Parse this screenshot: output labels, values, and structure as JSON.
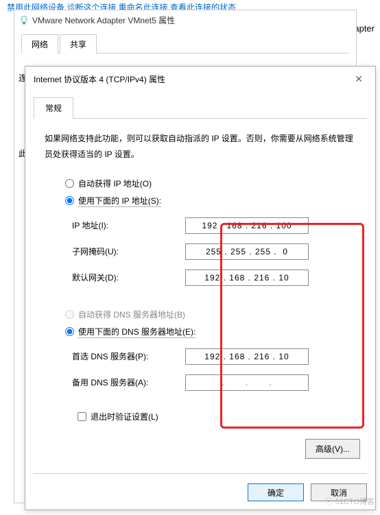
{
  "background": {
    "top_row": "禁用此网络设备    诊断这个连接    重命名此连接    查看此连接的状态",
    "right_fragment": "k Adapter"
  },
  "parent": {
    "title": "VMware Network Adapter VMnet5 属性",
    "tabs": [
      "网络",
      "共享"
    ],
    "left_label_1": "连",
    "left_label_2": "此"
  },
  "dialog": {
    "title": "Internet 协议版本 4 (TCP/IPv4) 属性",
    "tab": "常规",
    "description": "如果网络支持此功能，则可以获取自动指派的 IP 设置。否则，你需要从网络系统管理员处获得适当的 IP 设置。",
    "ip_section": {
      "radio_auto": "自动获得 IP 地址(O)",
      "radio_manual": "使用下面的 IP 地址(S):",
      "selected": "manual",
      "fields": {
        "ip_label": "IP 地址(I):",
        "ip_value": "192 . 168 . 216 . 100",
        "mask_label": "子网掩码(U):",
        "mask_value": "255 . 255 . 255 .  0",
        "gw_label": "默认网关(D):",
        "gw_value": "192 . 168 . 216 . 10"
      }
    },
    "dns_section": {
      "radio_auto": "自动获得 DNS 服务器地址(B)",
      "radio_manual": "使用下面的 DNS 服务器地址(E):",
      "selected": "manual",
      "fields": {
        "pref_label": "首选 DNS 服务器(P):",
        "pref_value": "192 . 168 . 216 . 10",
        "alt_label": "备用 DNS 服务器(A):",
        "alt_value": " .       .       . "
      }
    },
    "validate_label": "退出时验证设置(L)",
    "advanced_label": "高级(V)...",
    "ok_label": "确定",
    "cancel_label": "取消"
  },
  "watermark": "ⓒ 51CTO博客"
}
